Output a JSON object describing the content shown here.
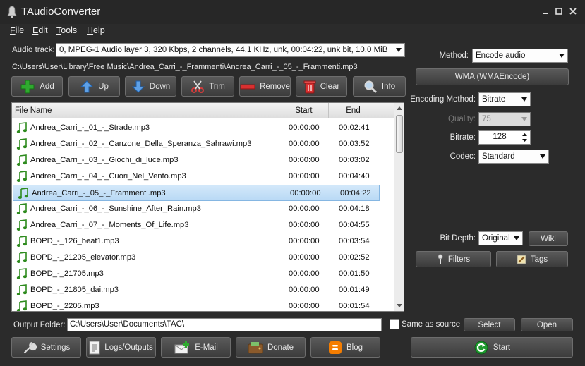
{
  "window": {
    "title": "TAudioConverter"
  },
  "menu": {
    "items": [
      {
        "label": "File",
        "hotkey": "F",
        "rest": "ile"
      },
      {
        "label": "Edit",
        "hotkey": "E",
        "rest": "dit"
      },
      {
        "label": "Tools",
        "hotkey": "T",
        "rest": "ools"
      },
      {
        "label": "Help",
        "hotkey": "H",
        "rest": "elp"
      }
    ]
  },
  "audio_track": {
    "label": "Audio track:",
    "value": "0, MPEG-1 Audio layer 3, 320 Kbps, 2 channels, 44.1 KHz, unk, 00:04:22, unk bit, 10.0 MiB"
  },
  "current_path": "C:\\Users\\User\\Library\\Free Music\\Andrea_Carri_-_Frammenti\\Andrea_Carri_-_05_-_Frammenti.mp3",
  "toolbar": {
    "add": "Add",
    "up": "Up",
    "down": "Down",
    "trim": "Trim",
    "remove": "Remove",
    "clear": "Clear",
    "info": "Info"
  },
  "file_list": {
    "columns": {
      "name": "File Name",
      "start": "Start",
      "end": "End"
    },
    "selected_index": 4,
    "rows": [
      {
        "name": "Andrea_Carri_-_01_-_Strade.mp3",
        "start": "00:00:00",
        "end": "00:02:41"
      },
      {
        "name": "Andrea_Carri_-_02_-_Canzone_Della_Speranza_Sahrawi.mp3",
        "start": "00:00:00",
        "end": "00:03:52"
      },
      {
        "name": "Andrea_Carri_-_03_-_Giochi_di_luce.mp3",
        "start": "00:00:00",
        "end": "00:03:02"
      },
      {
        "name": "Andrea_Carri_-_04_-_Cuori_Nel_Vento.mp3",
        "start": "00:00:00",
        "end": "00:04:40"
      },
      {
        "name": "Andrea_Carri_-_05_-_Frammenti.mp3",
        "start": "00:00:00",
        "end": "00:04:22"
      },
      {
        "name": "Andrea_Carri_-_06_-_Sunshine_After_Rain.mp3",
        "start": "00:00:00",
        "end": "00:04:18"
      },
      {
        "name": "Andrea_Carri_-_07_-_Moments_Of_Life.mp3",
        "start": "00:00:00",
        "end": "00:04:55"
      },
      {
        "name": "BOPD_-_126_beat1.mp3",
        "start": "00:00:00",
        "end": "00:03:54"
      },
      {
        "name": "BOPD_-_21205_elevator.mp3",
        "start": "00:00:00",
        "end": "00:02:52"
      },
      {
        "name": "BOPD_-_21705.mp3",
        "start": "00:00:00",
        "end": "00:01:50"
      },
      {
        "name": "BOPD_-_21805_dai.mp3",
        "start": "00:00:00",
        "end": "00:01:49"
      },
      {
        "name": "BOPD_-_2205.mp3",
        "start": "00:00:00",
        "end": "00:01:54"
      }
    ]
  },
  "settings_panel": {
    "method_label": "Method:",
    "method_value": "Encode audio",
    "encoder_button": "WMA (WMAEncode)",
    "encoding_method_label": "Encoding Method:",
    "encoding_method_value": "Bitrate",
    "quality_label": "Quality:",
    "quality_value": "75",
    "bitrate_label": "Bitrate:",
    "bitrate_value": "128",
    "codec_label": "Codec:",
    "codec_value": "Standard",
    "bit_depth_label": "Bit Depth:",
    "bit_depth_value": "Original",
    "wiki_button": "Wiki",
    "filters_button": "Filters",
    "tags_button": "Tags"
  },
  "output": {
    "label": "Output Folder:",
    "value": "C:\\Users\\User\\Documents\\TAC\\",
    "same_as_source_label": "Same as source",
    "select_button": "Select",
    "open_button": "Open"
  },
  "bottom_bar": {
    "settings": "Settings",
    "logs": "Logs/Outputs",
    "email": "E-Mail",
    "donate": "Donate",
    "blog": "Blog",
    "start": "Start"
  },
  "colors": {
    "background": "#2b2b2b",
    "selection": "#c6e1f8",
    "note_icon": "#2e8b1e",
    "add_icon": "#2faa2f",
    "start_icon": "#1e9a2e"
  }
}
